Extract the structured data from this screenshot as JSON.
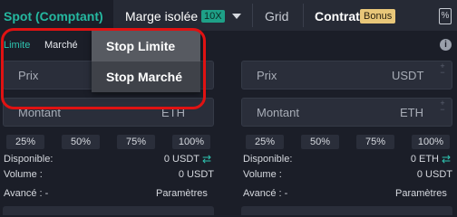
{
  "tabs": {
    "spot": "Spot (Comptant)",
    "marge": "Marge isolée",
    "leverage": "10X",
    "grid": "Grid",
    "contrat": "Contrat",
    "bonus": "Bonus"
  },
  "order_types": {
    "limit": "Limite",
    "market": "Marché"
  },
  "dropdown": {
    "items": [
      "Stop Limite",
      "Stop Marché"
    ],
    "selected": "Stop Limite"
  },
  "buy": {
    "price_label": "Prix",
    "amount_label": "Montant",
    "amount_unit": "ETH",
    "percents": [
      "25%",
      "50%",
      "75%",
      "100%"
    ],
    "available_label": "Disponible:",
    "available_value": "0 USDT",
    "volume_label": "Volume :",
    "volume_value": "0 USDT",
    "advanced_label": "Avancé : -",
    "params_label": "Paramètres"
  },
  "sell": {
    "price_label": "Prix",
    "price_unit": "USDT",
    "amount_label": "Montant",
    "amount_unit": "ETH",
    "percents": [
      "25%",
      "50%",
      "75%",
      "100%"
    ],
    "available_label": "Disponible:",
    "available_value": "0 ETH",
    "volume_label": "Volume :",
    "volume_value": "0 USDT",
    "advanced_label": "Avancé : -",
    "params_label": "Paramètres"
  },
  "icons": {
    "swap": "⇄",
    "info": "i",
    "percent": "%"
  },
  "colors": {
    "accent": "#2ec4b0",
    "highlight": "#e01212",
    "bonus": "#e8c779"
  }
}
